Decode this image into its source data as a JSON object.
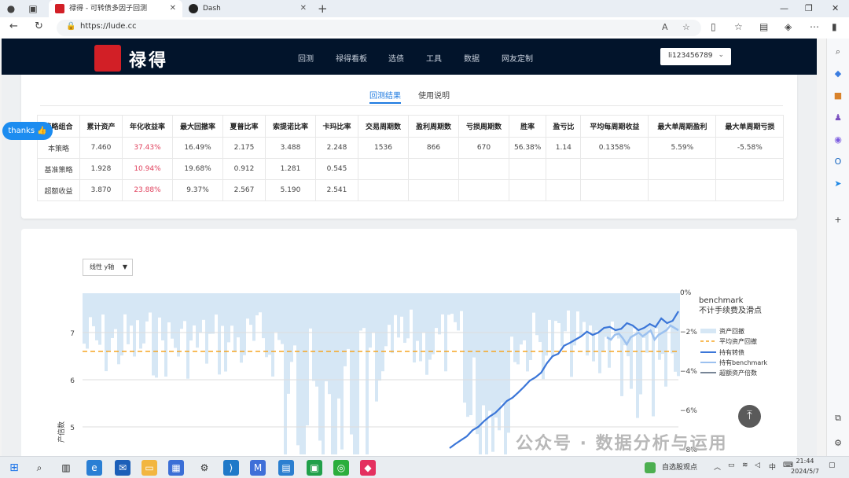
{
  "browser": {
    "tabs": [
      {
        "title": "禄得 - 可转债多因子回测",
        "active": true
      },
      {
        "title": "Dash",
        "active": false
      }
    ],
    "url": "https://lude.cc"
  },
  "site": {
    "logo_text": "禄得",
    "menu": [
      "回测",
      "禄得看板",
      "选债",
      "工具",
      "数据",
      "网友定制"
    ],
    "user": "li123456789"
  },
  "content_tabs": [
    "回测结果",
    "使用说明"
  ],
  "thanks_label": "thanks 👍",
  "table": {
    "headers": [
      "策略组合",
      "累计资产",
      "年化收益率",
      "最大回撤率",
      "夏普比率",
      "索提诺比率",
      "卡玛比率",
      "交易周期数",
      "盈利周期数",
      "亏损周期数",
      "胜率",
      "盈亏比",
      "平均每周期收益",
      "最大单周期盈利",
      "最大单周期亏损"
    ],
    "rows": [
      [
        "本策略",
        "7.460",
        "37.43%",
        "16.49%",
        "2.175",
        "3.488",
        "2.248",
        "1536",
        "866",
        "670",
        "56.38%",
        "1.14",
        "0.1358%",
        "5.59%",
        "-5.58%"
      ],
      [
        "基准策略",
        "1.928",
        "10.94%",
        "19.68%",
        "0.912",
        "1.281",
        "0.545",
        "",
        "",
        "",
        "",
        "",
        "",
        "",
        ""
      ],
      [
        "超额收益",
        "3.870",
        "23.88%",
        "9.37%",
        "2.567",
        "5.190",
        "2.541",
        "",
        "",
        "",
        "",
        "",
        "",
        "",
        ""
      ]
    ]
  },
  "scale_select": "线性 y轴",
  "chart_data": {
    "type": "line",
    "y_left_ticks": [
      "7",
      "6",
      "5"
    ],
    "y_left_label": "产倍数",
    "y_right_ticks": [
      "0%",
      "−2%",
      "−4%",
      "−6%",
      "−8%"
    ],
    "legend": {
      "title": "benchmark",
      "subtitle": "不计手续费及滑点",
      "items": [
        "资产回撤",
        "平均资产回撤",
        "持有转债",
        "持有benchmark",
        "超额资产倍数"
      ]
    },
    "colors": {
      "drawdown": "#d6e7f5",
      "avg_drawdown": "#f5a623",
      "strategy": "#3b76d8",
      "benchmark": "#9cc1ef",
      "excess": "#4b5d73"
    },
    "avg_drawdown_value": 6.6,
    "strategy_series": [
      4.55,
      4.64,
      4.72,
      4.8,
      4.93,
      5.0,
      5.12,
      5.22,
      5.3,
      5.42,
      5.55,
      5.62,
      5.73,
      5.85,
      5.98,
      6.05,
      6.15,
      6.35,
      6.5,
      6.55,
      6.72,
      6.78,
      6.85,
      6.92,
      7.02,
      6.95,
      7.0,
      7.1,
      7.12,
      7.05,
      7.08,
      7.2,
      7.15,
      7.05,
      7.1,
      7.18,
      7.12,
      7.3,
      7.2,
      7.25,
      7.45
    ],
    "benchmark_series": [
      6.9,
      6.85,
      6.95,
      6.98,
      6.88,
      6.75,
      6.9,
      6.95,
      7.0,
      6.92,
      6.98,
      7.05,
      6.85,
      6.95,
      7.0,
      7.05,
      7.15,
      7.1,
      7.05
    ]
  },
  "watermark": "公众号 · 数据分析与运用",
  "taskbar": {
    "news": "自选股观点",
    "time": "21:44",
    "date": "2024/5/7",
    "ime": "中"
  }
}
